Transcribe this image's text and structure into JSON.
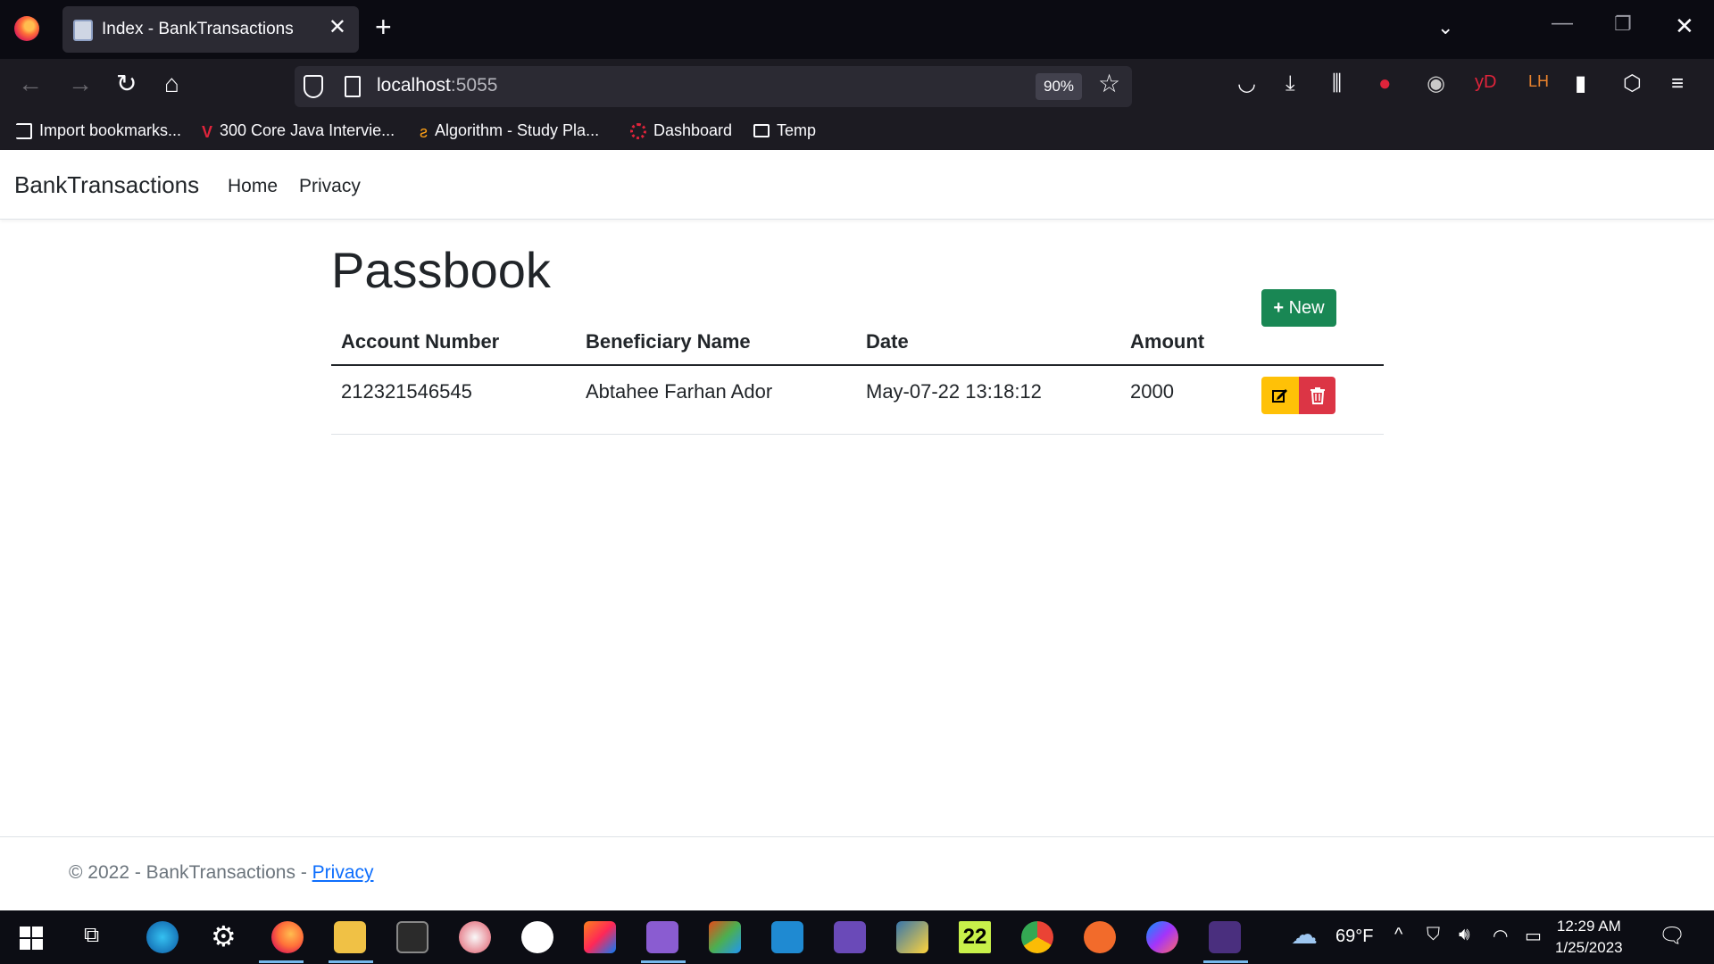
{
  "browser": {
    "tab_title": "Index - BankTransactions",
    "url_host": "localhost",
    "url_port": ":5055",
    "zoom": "90%",
    "bookmarks": [
      {
        "label": "Import bookmarks...",
        "icon": "import-icon"
      },
      {
        "label": "300 Core Java Intervie...",
        "icon": "v-logo-icon"
      },
      {
        "label": "Algorithm - Study Pla...",
        "icon": "leetcode-icon"
      },
      {
        "label": "Dashboard",
        "icon": "canvas-icon"
      },
      {
        "label": "Temp",
        "icon": "folder-icon"
      }
    ]
  },
  "app": {
    "brand": "BankTransactions",
    "nav": [
      "Home",
      "Privacy"
    ],
    "heading": "Passbook",
    "table": {
      "headers": [
        "Account Number",
        "Beneficiary Name",
        "Date",
        "Amount"
      ],
      "rows": [
        {
          "account": "212321546545",
          "beneficiary": "Abtahee Farhan Ador",
          "date": "May-07-22 13:18:12",
          "amount": "2000"
        }
      ]
    },
    "new_button": "New",
    "footer_text": "© 2022 - BankTransactions - ",
    "footer_link": "Privacy",
    "colors": {
      "new": "#198754",
      "edit": "#ffc107",
      "delete": "#dc3545",
      "link": "#0d6efd"
    }
  },
  "taskbar": {
    "weather": "69°F",
    "time": "12:29 AM",
    "date": "1/25/2023",
    "badge": "22"
  }
}
